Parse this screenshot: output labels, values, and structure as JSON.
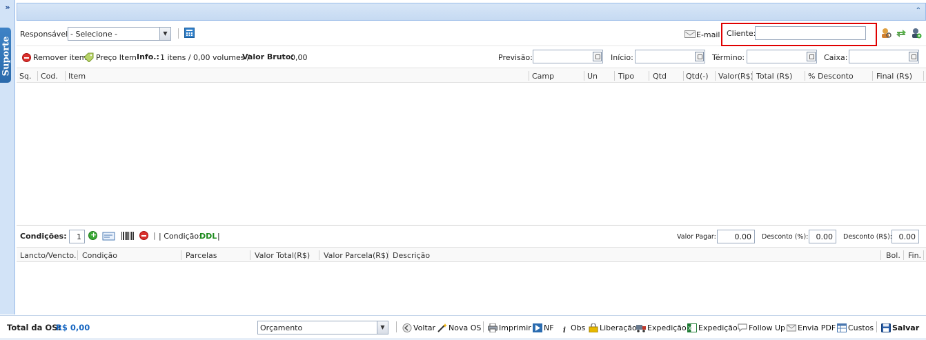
{
  "sidebar": {
    "expand_glyph": "»",
    "support_label": "Suporte"
  },
  "header": {
    "collapse_glyph": "«"
  },
  "toolbar": {
    "responsavel_label": "Responsável:",
    "responsavel_value": "- Selecione -",
    "email_label": "E-mail",
    "cliente_label": "Cliente:",
    "cliente_value": ""
  },
  "info_bar": {
    "remove_item": "Remover item",
    "preco_item": "Preço Item",
    "info_label": "Info.:",
    "info_text": "1 itens / 0,00 volumes /",
    "valor_bruto_label": "Valor Bruto:",
    "valor_bruto_value": "0,00",
    "previsao_label": "Previsão:",
    "inicio_label": "Início:",
    "termino_label": "Término:",
    "caixa_label": "Caixa:"
  },
  "items_table": {
    "columns": [
      "Sq.",
      "Cod.",
      "Item",
      "Camp",
      "Un",
      "Tipo",
      "Qtd",
      "Qtd(-)",
      "Valor(R$)",
      "Total (R$)",
      "% Desconto",
      "Final (R$)"
    ]
  },
  "conditions": {
    "label": "Condições:",
    "count": "1",
    "condicao_label": "| Condição:",
    "condicao_value": "DDL",
    "condicao_end": "|",
    "valor_pagar_label": "Valor Pagar:",
    "valor_pagar_value": "0.00",
    "desconto_pct_label": "Desconto (%):",
    "desconto_pct_value": "0.00",
    "desconto_rs_label": "Desconto (R$):",
    "desconto_rs_value": "0.00"
  },
  "payments_table": {
    "columns": [
      "Lancto/Vencto.",
      "Condição",
      "Parcelas",
      "Valor Total(R$)",
      "Valor Parcela(R$)",
      "Descrição",
      "Bol.",
      "Fin."
    ]
  },
  "footer": {
    "total_label": "Total da OS:",
    "total_value": "R$ 0,00",
    "status_value": "Orçamento",
    "buttons": {
      "voltar": "Voltar",
      "nova_os": "Nova OS",
      "imprimir": "Imprimir",
      "nf": "NF",
      "obs": "Obs",
      "liberacao": "Liberação",
      "expedicao1": "Expedição",
      "expedicao2": "Expedição",
      "follow_up": "Follow Up",
      "envia_pdf": "Envia PDF",
      "custos": "Custos",
      "salvar": "Salvar"
    }
  },
  "colors": {
    "accent": "#15428b",
    "total_value": "#1565c0",
    "condicao_value": "#1c8a1c",
    "highlight": "#e00000"
  }
}
